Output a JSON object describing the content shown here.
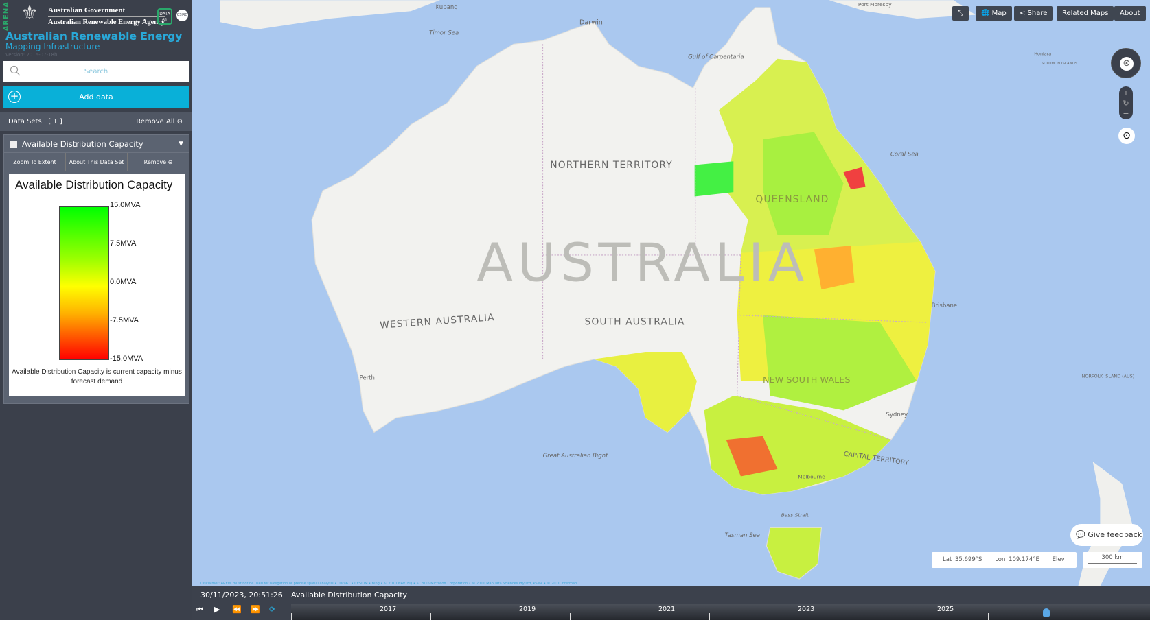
{
  "header": {
    "vertical_logo": "ARENA",
    "gov_line1": "Australian Government",
    "gov_line2": "Australian Renewable Energy Agency",
    "data61": "DATA 61",
    "csiro": "CSIRO",
    "title": "Australian Renewable Energy",
    "subtitle": "Mapping Infrastructure",
    "version": "Version: 2016-07-18b"
  },
  "search": {
    "placeholder": "Search"
  },
  "add_data": "Add data",
  "datasets": {
    "label": "Data Sets",
    "count": "[ 1 ]",
    "remove_all": "Remove All"
  },
  "dataset": {
    "name": "Available Distribution Capacity",
    "zoom_to_extent": "Zoom To Extent",
    "about": "About This Data Set",
    "remove": "Remove",
    "legend": {
      "title": "Available Distribution Capacity",
      "ticks": [
        "15.0MVA",
        "7.5MVA",
        "0.0MVA",
        "-7.5MVA",
        "-15.0MVA"
      ],
      "colors": [
        "#00ff00",
        "#ffff00",
        "#ff0000"
      ],
      "description": "Available Distribution Capacity is current capacity minus forecast demand"
    }
  },
  "toolbar": {
    "map": "Map",
    "share": "Share",
    "related_maps": "Related Maps",
    "about": "About"
  },
  "map_labels": {
    "timor_sea": "Timor Sea",
    "kupang": "Kupang",
    "darwin": "Darwin",
    "gulf": "Gulf of Carpentaria",
    "coral_sea": "Coral Sea",
    "nt": "NORTHERN TERRITORY",
    "qld": "QUEENSLAND",
    "australia": "AUSTRALIA",
    "wa": "WESTERN AUSTRALIA",
    "sa": "SOUTH AUSTRALIA",
    "nsw": "NEW SOUTH WALES",
    "act": "CAPITAL TERRITORY",
    "brisbane": "Brisbane",
    "perth": "Perth",
    "sydney": "Sydney",
    "melbourne": "Melbourne",
    "bight": "Great Australian Bight",
    "bass": "Bass Strait",
    "tasman": "Tasman Sea",
    "norfolk": "NORFOLK ISLAND (AUS)",
    "honiara": "Honiara",
    "solomon": "SOLOMON ISLANDS",
    "moresby": "Port Moresby"
  },
  "feedback": "Give feedback",
  "coords": {
    "lat_label": "Lat",
    "lat": "35.699°S",
    "lon_label": "Lon",
    "lon": "109.174°E",
    "elev_label": "Elev"
  },
  "scale": "300 km",
  "disclaimer": "Disclaimer: AREMI must not be used for navigation or precise spatial analysis • Data61 • CESIUM • Bing • © 2010 NAVTEQ • © 2016 Microsoft Corporation • © 2010 MapData Sciences Pty Ltd, PSMA • © 2010 Intermap",
  "timeline": {
    "datetime": "30/11/2023, 20:51:26",
    "layer": "Available Distribution Capacity",
    "years": [
      "2017",
      "2019",
      "2021",
      "2023",
      "2025"
    ]
  }
}
